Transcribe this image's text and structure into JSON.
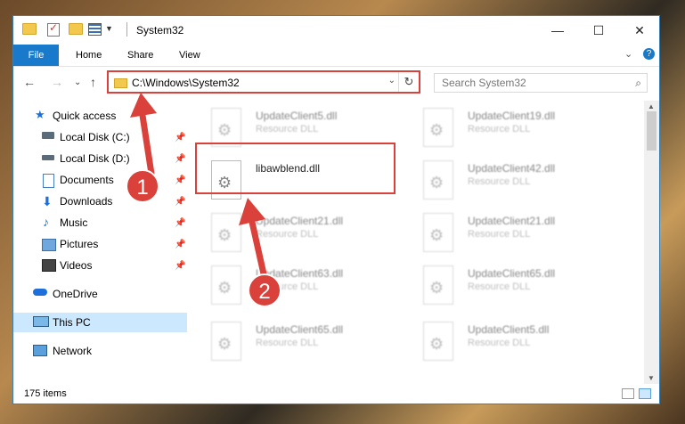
{
  "window": {
    "title": "System32",
    "controls": {
      "minimize": "—",
      "maximize": "☐",
      "close": "✕"
    }
  },
  "ribbon": {
    "file_tab": "File",
    "tabs": [
      "Home",
      "Share",
      "View"
    ],
    "collapse_icon": "⌄",
    "help_icon": "?"
  },
  "nav": {
    "back_icon": "←",
    "forward_icon": "→",
    "recent_icon": "⌄",
    "up_icon": "↑",
    "address": "C:\\Windows\\System32",
    "address_dropdown_icon": "⌄",
    "refresh_icon": "↻",
    "search_placeholder": "Search System32",
    "search_icon": "⌕"
  },
  "sidebar": {
    "items": [
      {
        "label": "Quick access",
        "icon": "star-icon",
        "pinned": false
      },
      {
        "label": "Local Disk (C:)",
        "icon": "drive-icon",
        "pinned": true
      },
      {
        "label": "Local Disk (D:)",
        "icon": "drive-icon",
        "pinned": true
      },
      {
        "label": "Documents",
        "icon": "documents-icon",
        "pinned": true
      },
      {
        "label": "Downloads",
        "icon": "download-icon",
        "pinned": true
      },
      {
        "label": "Music",
        "icon": "music-icon",
        "pinned": true
      },
      {
        "label": "Pictures",
        "icon": "pictures-icon",
        "pinned": true
      },
      {
        "label": "Videos",
        "icon": "videos-icon",
        "pinned": true
      },
      {
        "label": "OneDrive",
        "icon": "cloud-icon",
        "pinned": false
      },
      {
        "label": "This PC",
        "icon": "computer-icon",
        "pinned": false,
        "selected": true
      },
      {
        "label": "Network",
        "icon": "network-icon",
        "pinned": false
      }
    ]
  },
  "files": [
    {
      "name": "UpdateClient5.dll",
      "type": "Resource DLL"
    },
    {
      "name": "UpdateClient19.dll",
      "type": "Resource DLL"
    },
    {
      "name": "libawblend.dll",
      "type": ""
    },
    {
      "name": "UpdateClient42.dll",
      "type": "Resource DLL"
    },
    {
      "name": "UpdateClient21.dll",
      "type": "Resource DLL"
    },
    {
      "name": "UpdateClient21.dll",
      "type": "Resource DLL"
    },
    {
      "name": "UpdateClient63.dll",
      "type": "Resource DLL"
    },
    {
      "name": "UpdateClient65.dll",
      "type": "Resource DLL"
    },
    {
      "name": "UpdateClient65.dll",
      "type": "Resource DLL"
    },
    {
      "name": "UpdateClient5.dll",
      "type": "Resource DLL"
    }
  ],
  "status": {
    "item_count": "175 items"
  },
  "annotations": {
    "step1": "1",
    "step2": "2",
    "color": "#d9413a"
  }
}
